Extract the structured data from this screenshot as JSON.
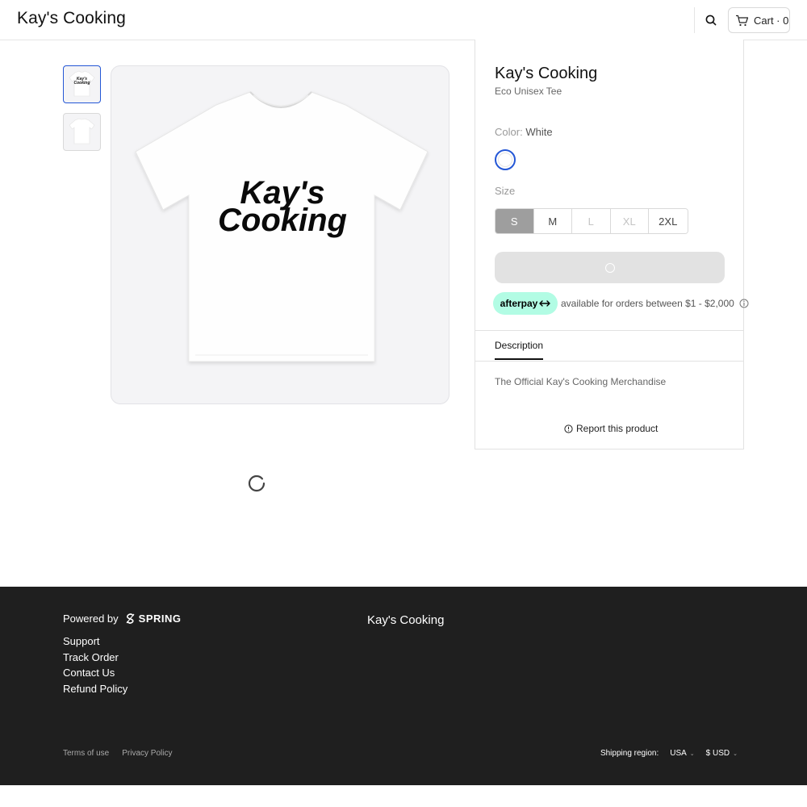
{
  "header": {
    "brand": "Kay's Cooking",
    "cart_label": "Cart · 0"
  },
  "gallery": {
    "shirt_line1": "Kay's",
    "shirt_line2": "Cooking"
  },
  "product": {
    "title": "Kay's Cooking",
    "subtitle": "Eco Unisex Tee",
    "color_label": "Color:",
    "color_value": "White",
    "size_label": "Size",
    "sizes": [
      "S",
      "M",
      "L",
      "XL",
      "2XL"
    ],
    "selected_size": "S",
    "disabled_sizes": [
      "L",
      "XL"
    ],
    "afterpay_brand": "afterpay",
    "afterpay_text": "available for orders between $1 - $2,000",
    "tab_description": "Description",
    "description": "The Official Kay's Cooking Merchandise",
    "report_label": "Report this product"
  },
  "footer": {
    "powered_by": "Powered by",
    "spring": "SPRING",
    "links": [
      "Support",
      "Track Order",
      "Contact Us",
      "Refund Policy"
    ],
    "brand": "Kay's Cooking",
    "terms": "Terms of use",
    "privacy": "Privacy Policy",
    "shipping_label": "Shipping region:",
    "region": "USA",
    "currency": "$ USD"
  },
  "colors": {
    "accent": "#2457d6",
    "afterpay": "#b2fce4",
    "footer_bg": "#1f1f1f"
  }
}
